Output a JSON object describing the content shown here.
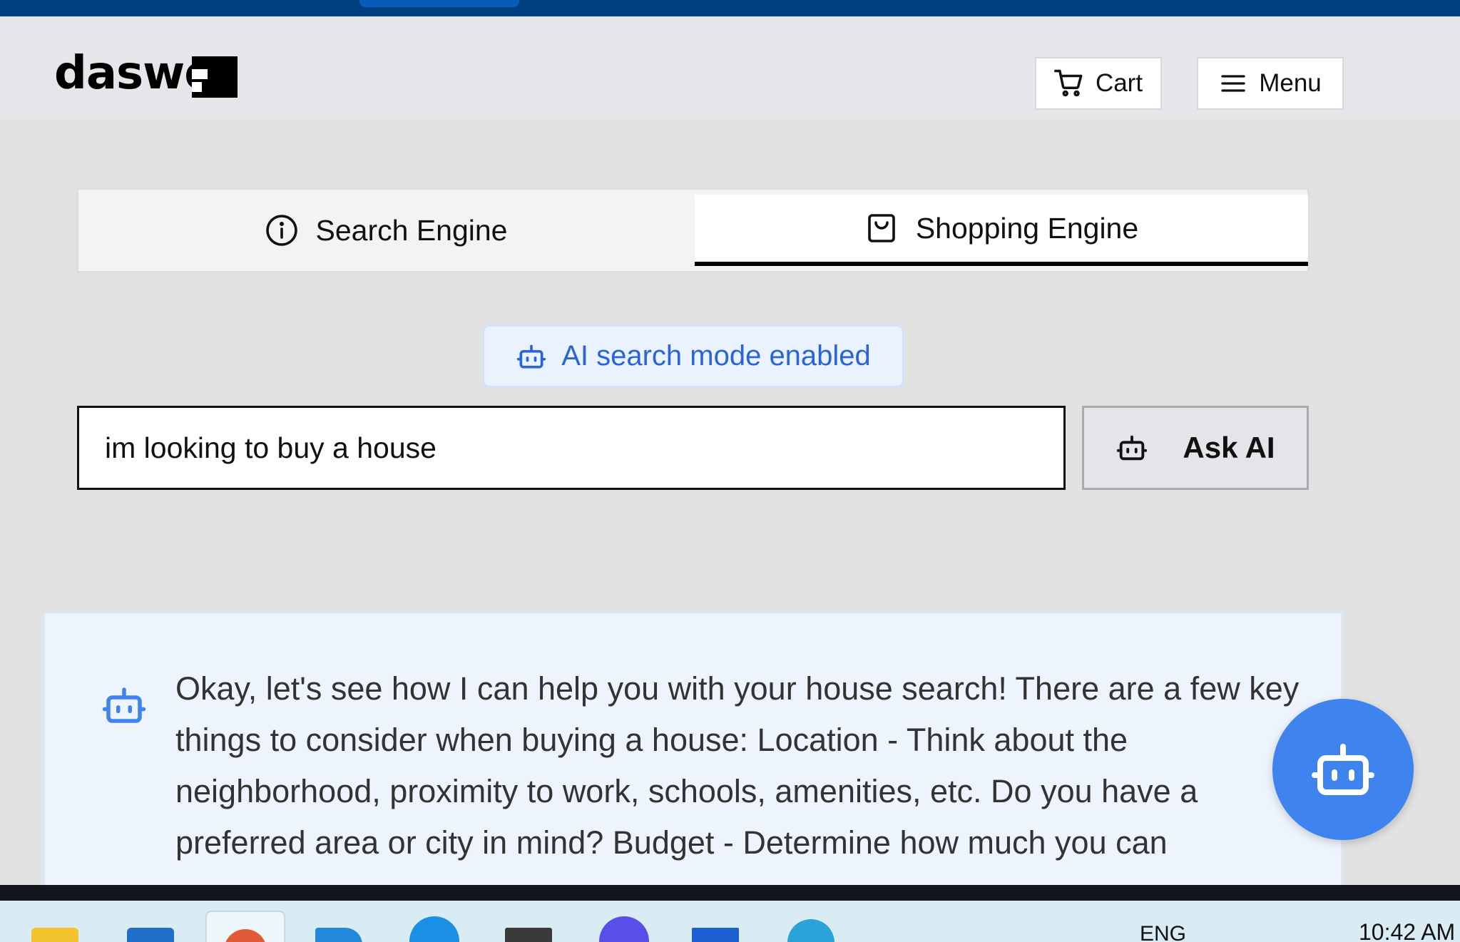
{
  "logo": {
    "text": "daswo"
  },
  "header": {
    "cart_label": "Cart",
    "menu_label": "Menu"
  },
  "tabs": [
    {
      "label": "Search Engine",
      "icon": "info-icon",
      "active": false
    },
    {
      "label": "Shopping Engine",
      "icon": "shopping-bag-icon",
      "active": true
    }
  ],
  "ai_mode": {
    "label": "AI search mode enabled",
    "icon": "robot-icon"
  },
  "search": {
    "value": "im looking to buy a house",
    "placeholder": ""
  },
  "ask_button": {
    "label": "Ask AI",
    "icon": "robot-icon"
  },
  "response": {
    "text": "Okay, let's see how I can help you with your house search! There are a few key things to consider when buying a house: Location - Think about the neighborhood, proximity to work, schools, amenities, etc. Do you have a preferred area or city in mind? Budget - Determine how much you can"
  },
  "taskbar": {
    "language": "ENG",
    "time": "10:42 AM"
  },
  "colors": {
    "accent_blue": "#3f84ee",
    "badge_text": "#2b63d9",
    "top_strip": "#003f80"
  }
}
